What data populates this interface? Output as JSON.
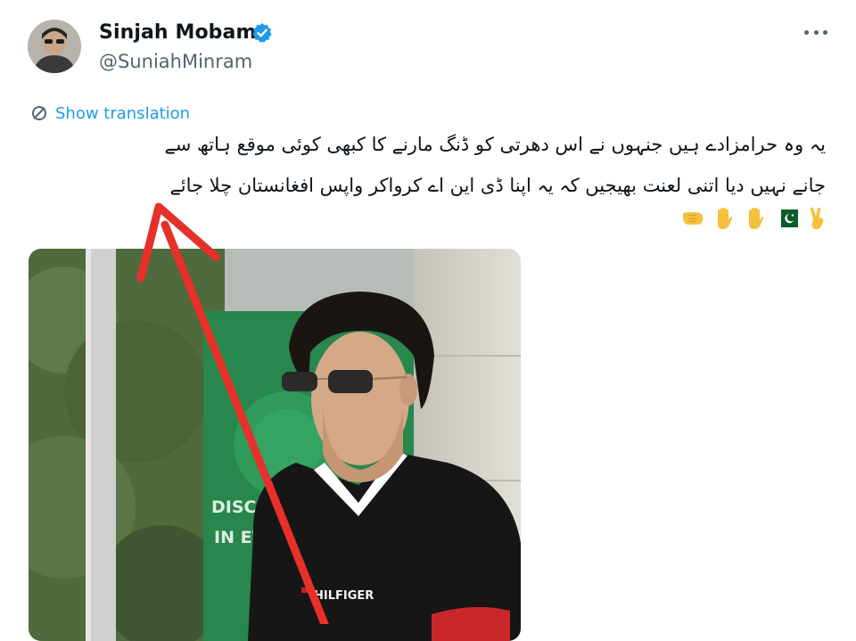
{
  "tweet": {
    "display_name": "Sinjah Mobam",
    "handle": "@SuniahMinram",
    "show_translation": "Show translation",
    "text_line1": "یہ وہ حرامزادے ہیں جنہوں نے اس دھرتی کو ڈنگ مارنے کا کبھی کوئی موقع ہاتھ سے",
    "text_line2": "جانے نہیں دیا اتنی لعنت بھیجیں کہ یہ اپنا ڈی این اے کرواکر واپس افغانستان چلا جائے",
    "emojis": [
      "victory-hand",
      "pakistan-flag",
      "raised-hand",
      "raised-hand",
      "fist"
    ]
  },
  "image": {
    "sign_text_1": "DISCOVER",
    "sign_text_2": "IN EVER",
    "shirt_brand": "HILFIGER"
  },
  "colors": {
    "link_blue": "#1d9bf0",
    "verified_blue": "#1d9bf0",
    "secondary_text": "#536471",
    "arrow_red": "#e8302a"
  }
}
